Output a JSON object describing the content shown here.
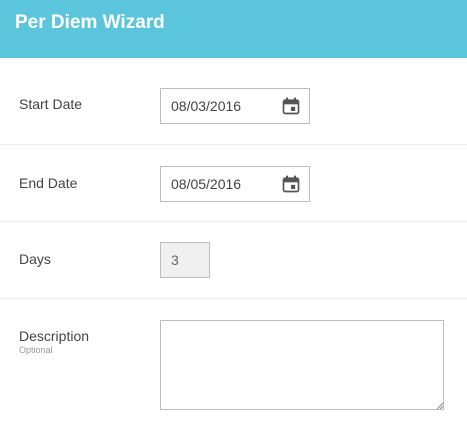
{
  "header": {
    "title": "Per Diem Wizard"
  },
  "form": {
    "start_date": {
      "label": "Start Date",
      "value": "08/03/2016",
      "icon": "calendar-icon"
    },
    "end_date": {
      "label": "End Date",
      "value": "08/05/2016",
      "icon": "calendar-icon"
    },
    "days": {
      "label": "Days",
      "value": "3"
    },
    "description": {
      "label": "Description",
      "sublabel": "Optional",
      "value": ""
    }
  },
  "colors": {
    "header_bg": "#5bc5dc",
    "header_text": "#ffffff"
  }
}
